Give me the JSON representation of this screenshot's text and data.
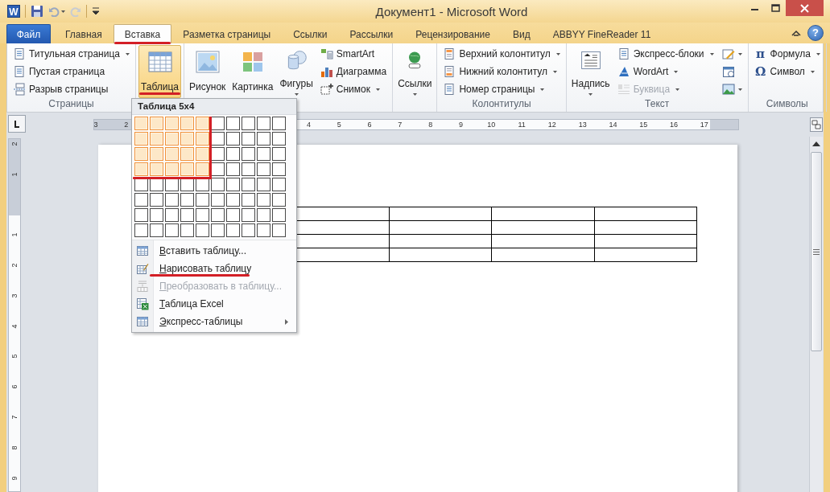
{
  "window": {
    "title": "Документ1 - Microsoft Word",
    "app_icon": "W"
  },
  "tabs": [
    {
      "label": "Файл",
      "kind": "file",
      "selected": false,
      "underlined": false
    },
    {
      "label": "Главная",
      "kind": "tab",
      "selected": false,
      "underlined": false
    },
    {
      "label": "Вставка",
      "kind": "tab",
      "selected": true,
      "underlined": true
    },
    {
      "label": "Разметка страницы",
      "kind": "tab",
      "selected": false,
      "underlined": false
    },
    {
      "label": "Ссылки",
      "kind": "tab",
      "selected": false,
      "underlined": false
    },
    {
      "label": "Рассылки",
      "kind": "tab",
      "selected": false,
      "underlined": false
    },
    {
      "label": "Рецензирование",
      "kind": "tab",
      "selected": false,
      "underlined": false
    },
    {
      "label": "Вид",
      "kind": "tab",
      "selected": false,
      "underlined": false
    },
    {
      "label": "ABBYY FineReader 11",
      "kind": "tab",
      "selected": false,
      "underlined": false
    }
  ],
  "help": "?",
  "ribbon": {
    "groups": [
      {
        "label": "Страницы",
        "columns": [
          {
            "items": [
              {
                "kind": "small",
                "label": "Титульная страница",
                "dropdown": true,
                "pressed": false,
                "disabled": false,
                "underlined": false
              },
              {
                "kind": "small",
                "label": "Пустая страница",
                "dropdown": false,
                "pressed": false,
                "disabled": false,
                "underlined": false
              },
              {
                "kind": "small",
                "label": "Разрыв страницы",
                "dropdown": false,
                "pressed": false,
                "disabled": false,
                "underlined": false
              }
            ]
          }
        ]
      },
      {
        "columns": [
          {
            "items": [
              {
                "kind": "large",
                "label": "Таблица",
                "dropdown": false,
                "pressed": true,
                "disabled": false,
                "underlined": true
              }
            ]
          }
        ]
      },
      {
        "columns": [
          {
            "items": [
              {
                "kind": "large",
                "label": "Рисунок",
                "dropdown": false,
                "pressed": false,
                "disabled": false,
                "underlined": false
              }
            ]
          },
          {
            "items": [
              {
                "kind": "large",
                "label": "Картинка",
                "dropdown": false,
                "pressed": false,
                "disabled": false,
                "underlined": false
              }
            ]
          },
          {
            "items": [
              {
                "kind": "large",
                "label": "Фигуры",
                "dropdown": true,
                "pressed": false,
                "disabled": false,
                "underlined": false
              }
            ]
          },
          {
            "items": [
              {
                "kind": "small",
                "label": "SmartArt",
                "dropdown": false,
                "pressed": false,
                "disabled": false,
                "underlined": false
              },
              {
                "kind": "small",
                "label": "Диаграмма",
                "dropdown": false,
                "pressed": false,
                "disabled": false,
                "underlined": false
              },
              {
                "kind": "small",
                "label": "Снимок",
                "dropdown": true,
                "pressed": false,
                "disabled": false,
                "underlined": false
              }
            ]
          }
        ]
      },
      {
        "columns": [
          {
            "items": [
              {
                "kind": "large",
                "label": "Ссылки",
                "dropdown": true,
                "pressed": false,
                "disabled": false,
                "underlined": false
              }
            ]
          }
        ]
      },
      {
        "label": "Колонтитулы",
        "columns": [
          {
            "items": [
              {
                "kind": "small",
                "label": "Верхний колонтитул",
                "dropdown": true,
                "pressed": false,
                "disabled": false,
                "underlined": false
              },
              {
                "kind": "small",
                "label": "Нижний колонтитул",
                "dropdown": true,
                "pressed": false,
                "disabled": false,
                "underlined": false
              },
              {
                "kind": "small",
                "label": "Номер страницы",
                "dropdown": true,
                "pressed": false,
                "disabled": false,
                "underlined": false
              }
            ]
          }
        ]
      },
      {
        "label": "Текст",
        "columns": [
          {
            "items": [
              {
                "kind": "large",
                "label": "Надпись",
                "dropdown": true,
                "pressed": false,
                "disabled": false,
                "underlined": false
              }
            ]
          },
          {
            "items": [
              {
                "kind": "small",
                "label": "Экспресс-блоки",
                "dropdown": true,
                "pressed": false,
                "disabled": false,
                "underlined": false
              },
              {
                "kind": "small",
                "label": "WordArt",
                "dropdown": true,
                "pressed": false,
                "disabled": false,
                "underlined": false
              },
              {
                "kind": "small",
                "label": "Буквица",
                "dropdown": true,
                "pressed": false,
                "disabled": true,
                "underlined": false
              }
            ]
          },
          {
            "items": [
              {
                "kind": "icon",
                "dropdown": true,
                "pressed": false,
                "disabled": false,
                "underlined": false
              },
              {
                "kind": "icon",
                "dropdown": false,
                "pressed": false,
                "disabled": false,
                "underlined": false
              },
              {
                "kind": "icon",
                "dropdown": true,
                "pressed": false,
                "disabled": false,
                "underlined": false
              }
            ]
          }
        ]
      },
      {
        "label": "Символы",
        "columns": [
          {
            "items": [
              {
                "kind": "small",
                "glyph": "π",
                "label": "Формула",
                "dropdown": true,
                "pressed": false,
                "disabled": false,
                "underlined": false
              },
              {
                "kind": "small",
                "glyph": "Ω",
                "label": "Символ",
                "dropdown": true,
                "pressed": false,
                "disabled": false,
                "underlined": false
              }
            ]
          }
        ]
      }
    ]
  },
  "table_menu": {
    "title": "Таблица 5x4",
    "outlined": true,
    "grid": [
      {
        "cells": [
          {
            "selected": true
          },
          {
            "selected": true
          },
          {
            "selected": true
          },
          {
            "selected": true
          },
          {
            "selected": true
          },
          {
            "selected": false
          },
          {
            "selected": false
          },
          {
            "selected": false
          },
          {
            "selected": false
          },
          {
            "selected": false
          }
        ]
      },
      {
        "cells": [
          {
            "selected": true
          },
          {
            "selected": true
          },
          {
            "selected": true
          },
          {
            "selected": true
          },
          {
            "selected": true
          },
          {
            "selected": false
          },
          {
            "selected": false
          },
          {
            "selected": false
          },
          {
            "selected": false
          },
          {
            "selected": false
          }
        ]
      },
      {
        "cells": [
          {
            "selected": true
          },
          {
            "selected": true
          },
          {
            "selected": true
          },
          {
            "selected": true
          },
          {
            "selected": true
          },
          {
            "selected": false
          },
          {
            "selected": false
          },
          {
            "selected": false
          },
          {
            "selected": false
          },
          {
            "selected": false
          }
        ]
      },
      {
        "cells": [
          {
            "selected": true
          },
          {
            "selected": true
          },
          {
            "selected": true
          },
          {
            "selected": true
          },
          {
            "selected": true
          },
          {
            "selected": false
          },
          {
            "selected": false
          },
          {
            "selected": false
          },
          {
            "selected": false
          },
          {
            "selected": false
          }
        ]
      },
      {
        "cells": [
          {
            "selected": false
          },
          {
            "selected": false
          },
          {
            "selected": false
          },
          {
            "selected": false
          },
          {
            "selected": false
          },
          {
            "selected": false
          },
          {
            "selected": false
          },
          {
            "selected": false
          },
          {
            "selected": false
          },
          {
            "selected": false
          }
        ]
      },
      {
        "cells": [
          {
            "selected": false
          },
          {
            "selected": false
          },
          {
            "selected": false
          },
          {
            "selected": false
          },
          {
            "selected": false
          },
          {
            "selected": false
          },
          {
            "selected": false
          },
          {
            "selected": false
          },
          {
            "selected": false
          },
          {
            "selected": false
          }
        ]
      },
      {
        "cells": [
          {
            "selected": false
          },
          {
            "selected": false
          },
          {
            "selected": false
          },
          {
            "selected": false
          },
          {
            "selected": false
          },
          {
            "selected": false
          },
          {
            "selected": false
          },
          {
            "selected": false
          },
          {
            "selected": false
          },
          {
            "selected": false
          }
        ]
      },
      {
        "cells": [
          {
            "selected": false
          },
          {
            "selected": false
          },
          {
            "selected": false
          },
          {
            "selected": false
          },
          {
            "selected": false
          },
          {
            "selected": false
          },
          {
            "selected": false
          },
          {
            "selected": false
          },
          {
            "selected": false
          },
          {
            "selected": false
          }
        ]
      }
    ],
    "items": [
      {
        "label": "Вставить таблицу...",
        "disabled": false,
        "submenu": false,
        "underlined": false
      },
      {
        "label": "Нарисовать таблицу",
        "disabled": false,
        "submenu": false,
        "underlined": true
      },
      {
        "label": "Преобразовать в таблицу...",
        "disabled": true,
        "submenu": false,
        "underlined": false
      },
      {
        "label": "Таблица Excel",
        "disabled": false,
        "submenu": false,
        "underlined": false
      },
      {
        "label": "Экспресс-таблицы",
        "disabled": false,
        "submenu": true,
        "underlined": false
      }
    ]
  },
  "rulers": {
    "horizontal": {
      "left_labels": [
        "3",
        "2"
      ],
      "labels": [
        "4",
        "5",
        "6",
        "7",
        "8",
        "9",
        "10",
        "11",
        "12",
        "13",
        "14",
        "15",
        "16",
        "17"
      ]
    },
    "vertical": {
      "top_labels": [
        "2",
        "1"
      ],
      "labels": [
        "1",
        "2",
        "3",
        "4",
        "5",
        "6",
        "7",
        "8",
        "9"
      ]
    }
  },
  "document": {
    "table": {
      "rows": [
        {
          "cells": [
            {
              "kind": "empty"
            },
            {
              "kind": "empty"
            },
            {
              "kind": "empty"
            },
            {
              "kind": "empty"
            }
          ]
        },
        {
          "cells": [
            {
              "kind": "empty"
            },
            {
              "kind": "empty"
            },
            {
              "kind": "empty"
            },
            {
              "kind": "empty"
            }
          ]
        },
        {
          "cells": [
            {
              "kind": "empty"
            },
            {
              "kind": "empty"
            },
            {
              "kind": "empty"
            },
            {
              "kind": "empty"
            }
          ]
        },
        {
          "cells": [
            {
              "kind": "empty"
            },
            {
              "kind": "empty"
            },
            {
              "kind": "empty"
            },
            {
              "kind": "empty"
            }
          ]
        }
      ]
    }
  }
}
